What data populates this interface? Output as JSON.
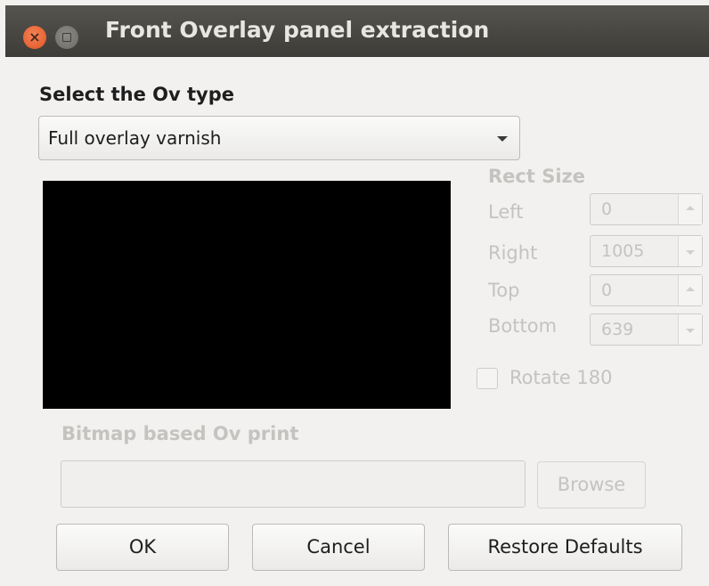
{
  "window": {
    "title": "Front Overlay panel extraction",
    "close_icon": "×"
  },
  "ov_type": {
    "label": "Select the Ov type",
    "selected": "Full overlay varnish"
  },
  "rect": {
    "heading": "Rect Size",
    "left": {
      "label": "Left",
      "value": "0"
    },
    "right": {
      "label": "Right",
      "value": "1005"
    },
    "top": {
      "label": "Top",
      "value": "0"
    },
    "bottom": {
      "label": "Bottom",
      "value": "639"
    }
  },
  "rotate": {
    "label": "Rotate 180",
    "checked": false
  },
  "bitmap": {
    "label": "Bitmap based Ov print",
    "value": "",
    "browse_label": "Browse"
  },
  "buttons": {
    "ok": "OK",
    "cancel": "Cancel",
    "restore": "Restore Defaults"
  }
}
